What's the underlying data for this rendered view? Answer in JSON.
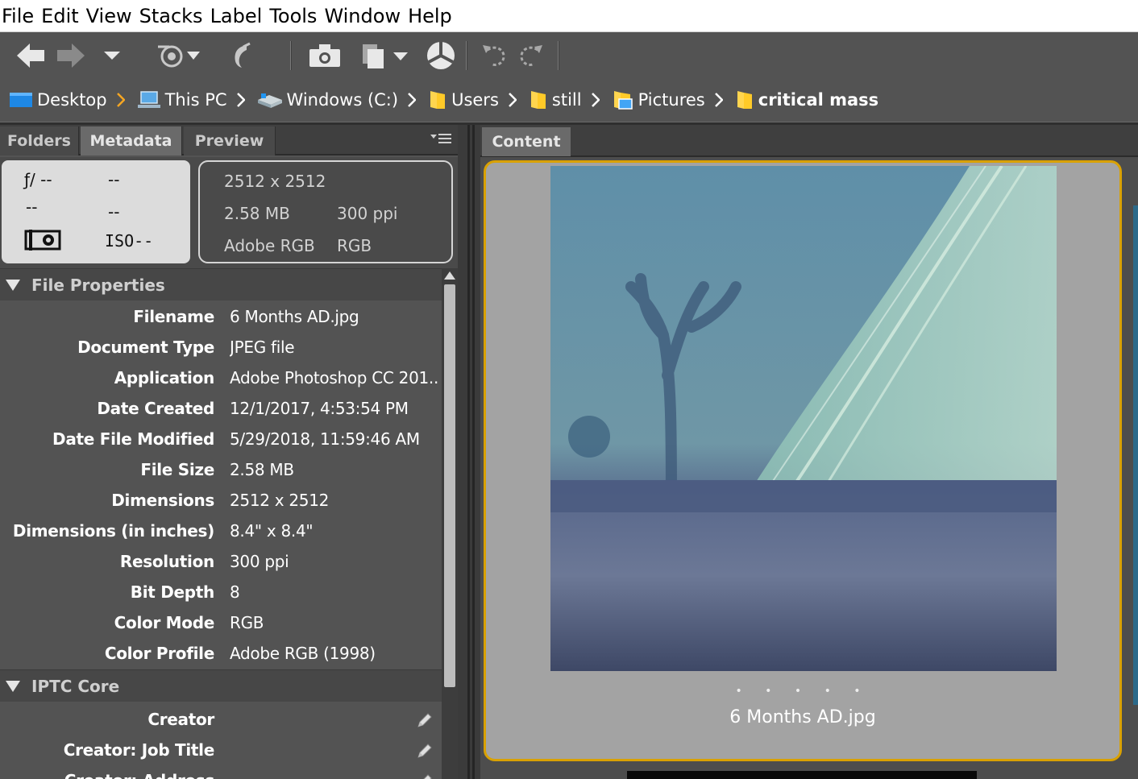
{
  "menu": [
    "File",
    "Edit",
    "View",
    "Stacks",
    "Label",
    "Tools",
    "Window",
    "Help"
  ],
  "toolbar": {
    "icons": [
      "back-arrow-icon",
      "forward-arrow-icon",
      "recent-folders-dropdown-icon",
      "reveal-recent-icon",
      "return-to-photoshop-icon",
      "camera-import-icon",
      "copy-to-icon",
      "refine-icon",
      "rotate-left-icon",
      "rotate-right-icon"
    ]
  },
  "path": [
    {
      "label": "Desktop",
      "icon": "desktop-icon"
    },
    {
      "label": "This PC",
      "icon": "computer-icon"
    },
    {
      "label": "Windows (C:)",
      "icon": "drive-icon"
    },
    {
      "label": "Users",
      "icon": "folder-icon"
    },
    {
      "label": "still",
      "icon": "folder-icon"
    },
    {
      "label": "Pictures",
      "icon": "pictures-folder-icon"
    },
    {
      "label": "critical mass",
      "icon": "folder-icon"
    }
  ],
  "left_tabs": {
    "folders": "Folders",
    "metadata": "Metadata",
    "preview": "Preview"
  },
  "camera_summary": {
    "aperture": "ƒ/ --",
    "shutter": "--",
    "row2_left": "--",
    "row2_right": "--",
    "iso": "ISO--"
  },
  "file_summary": {
    "dimensions": "2512 x 2512",
    "size": "2.58 MB",
    "resolution": "300 ppi",
    "profile": "Adobe RGB",
    "mode": "RGB"
  },
  "file_properties": {
    "title": "File Properties",
    "rows": [
      {
        "key": "Filename",
        "value": "6 Months AD.jpg"
      },
      {
        "key": "Document Type",
        "value": "JPEG file"
      },
      {
        "key": "Application",
        "value": "Adobe Photoshop CC 201..."
      },
      {
        "key": "Date Created",
        "value": "12/1/2017, 4:53:54 PM"
      },
      {
        "key": "Date File Modified",
        "value": "5/29/2018, 11:59:46 AM"
      },
      {
        "key": "File Size",
        "value": "2.58 MB"
      },
      {
        "key": "Dimensions",
        "value": "2512 x 2512"
      },
      {
        "key": "Dimensions (in inches)",
        "value": "8.4\" x 8.4\""
      },
      {
        "key": "Resolution",
        "value": "300 ppi"
      },
      {
        "key": "Bit Depth",
        "value": "8"
      },
      {
        "key": "Color Mode",
        "value": "RGB"
      },
      {
        "key": "Color Profile",
        "value": "Adobe RGB (1998)"
      }
    ]
  },
  "iptc_core": {
    "title": "IPTC Core",
    "rows": [
      {
        "key": "Creator"
      },
      {
        "key": "Creator: Job Title"
      },
      {
        "key": "Creator: Address"
      }
    ]
  },
  "content": {
    "tab": "Content",
    "thumbnail_name": "6 Months AD.jpg",
    "rating_dots": "• • • • •"
  },
  "colors": {
    "panel_bg": "#535353",
    "selection_border": "#d9a100",
    "card_bg": "#a3a3a3"
  }
}
